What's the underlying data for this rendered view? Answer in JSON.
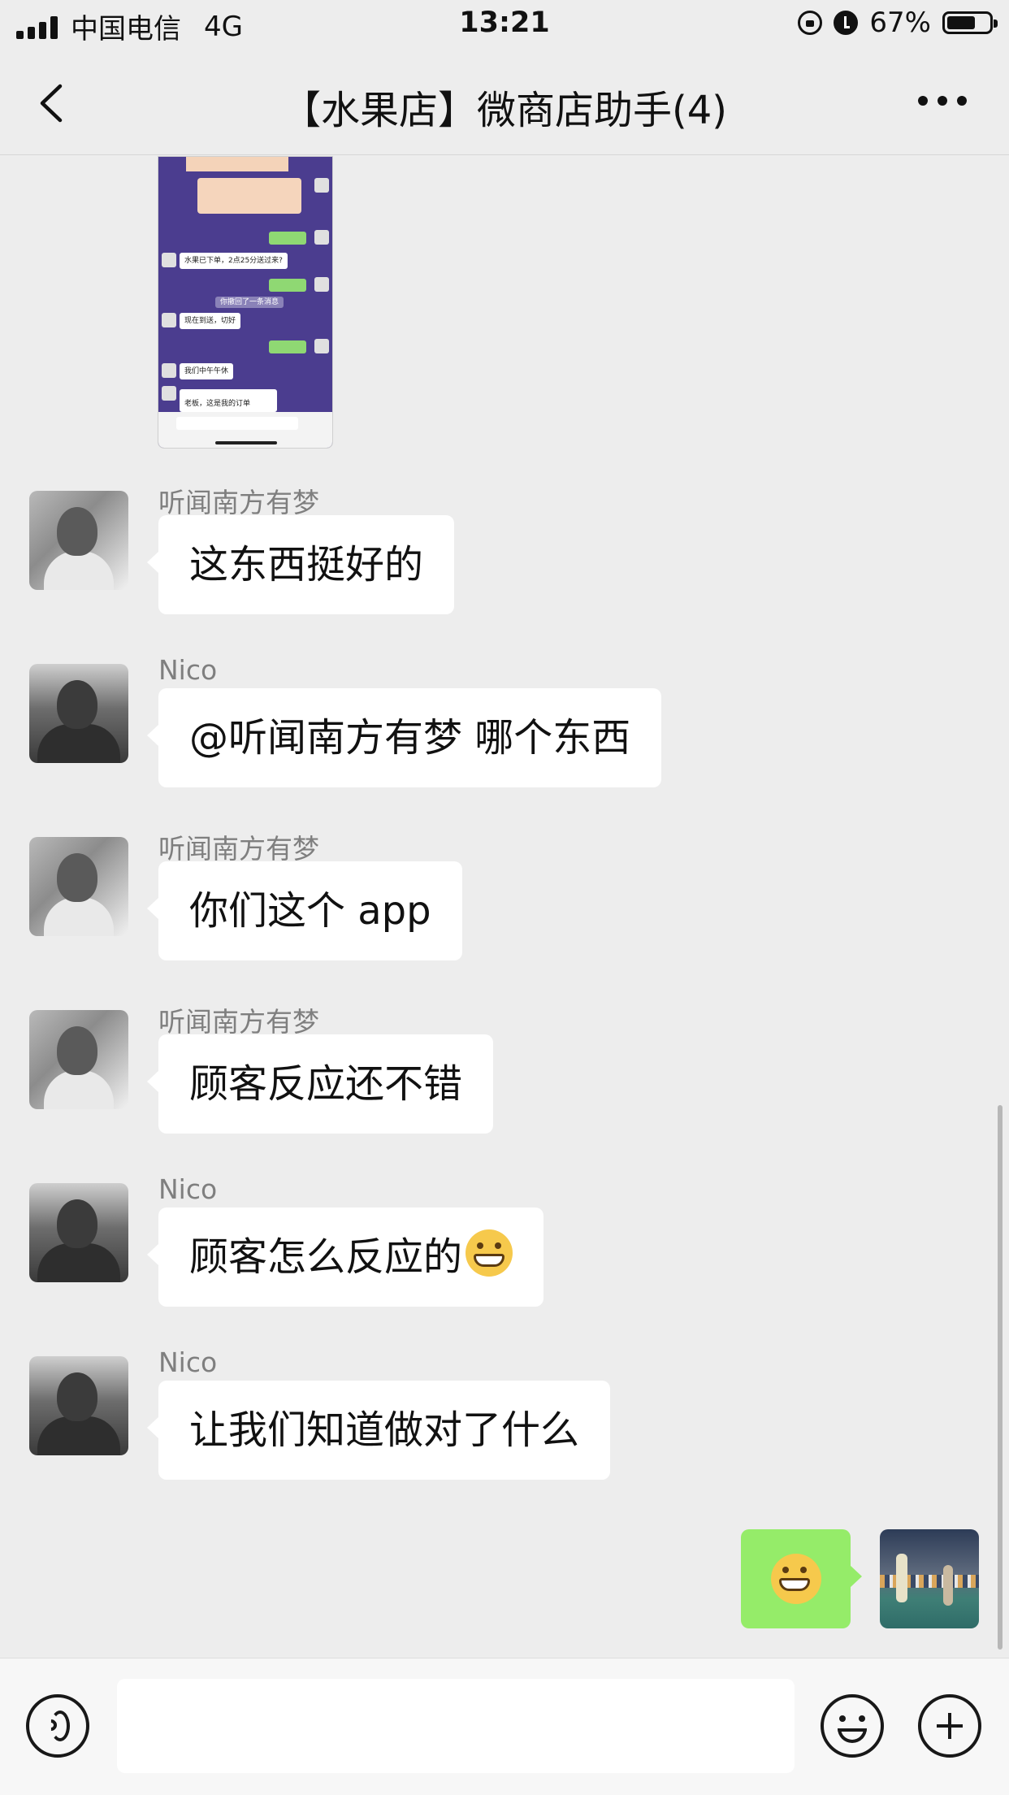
{
  "status_bar": {
    "carrier": "中国电信",
    "network": "4G",
    "time": "13:21",
    "battery_percent": "67%",
    "battery_level": 0.67
  },
  "nav": {
    "back_icon": "chevron-left-icon",
    "title": "【水果店】微商店助手(4)",
    "more_icon": "more-dots-icon"
  },
  "shared_screenshot": {
    "rows": [
      "水果已下单，2点25分送过来?",
      "你撤回了一条消息",
      "现在到送，切好",
      "我们中午午休",
      "老板，这是我的订单"
    ]
  },
  "messages": [
    {
      "sender": "听闻南方有梦",
      "text": "这东西挺好的",
      "avatar": "avatar-young-man"
    },
    {
      "sender": "Nico",
      "text": "@听闻南方有梦 哪个东西",
      "avatar": "avatar-bodybuilder"
    },
    {
      "sender": "听闻南方有梦",
      "text": "你们这个 app",
      "avatar": "avatar-young-man"
    },
    {
      "sender": "听闻南方有梦",
      "text": "顾客反应还不错",
      "avatar": "avatar-young-man"
    },
    {
      "sender": "Nico",
      "text": "顾客怎么反应的",
      "emoji": "grinning-face",
      "avatar": "avatar-bodybuilder"
    },
    {
      "sender": "Nico",
      "text": "让我们知道做对了什么",
      "avatar": "avatar-bodybuilder"
    }
  ],
  "my_message": {
    "emoji": "grinning-face",
    "avatar": "avatar-badminton-court"
  },
  "input_bar": {
    "voice_icon": "voice-icon",
    "placeholder": "",
    "emoji_icon": "smiley-icon",
    "plus_icon": "plus-icon"
  }
}
